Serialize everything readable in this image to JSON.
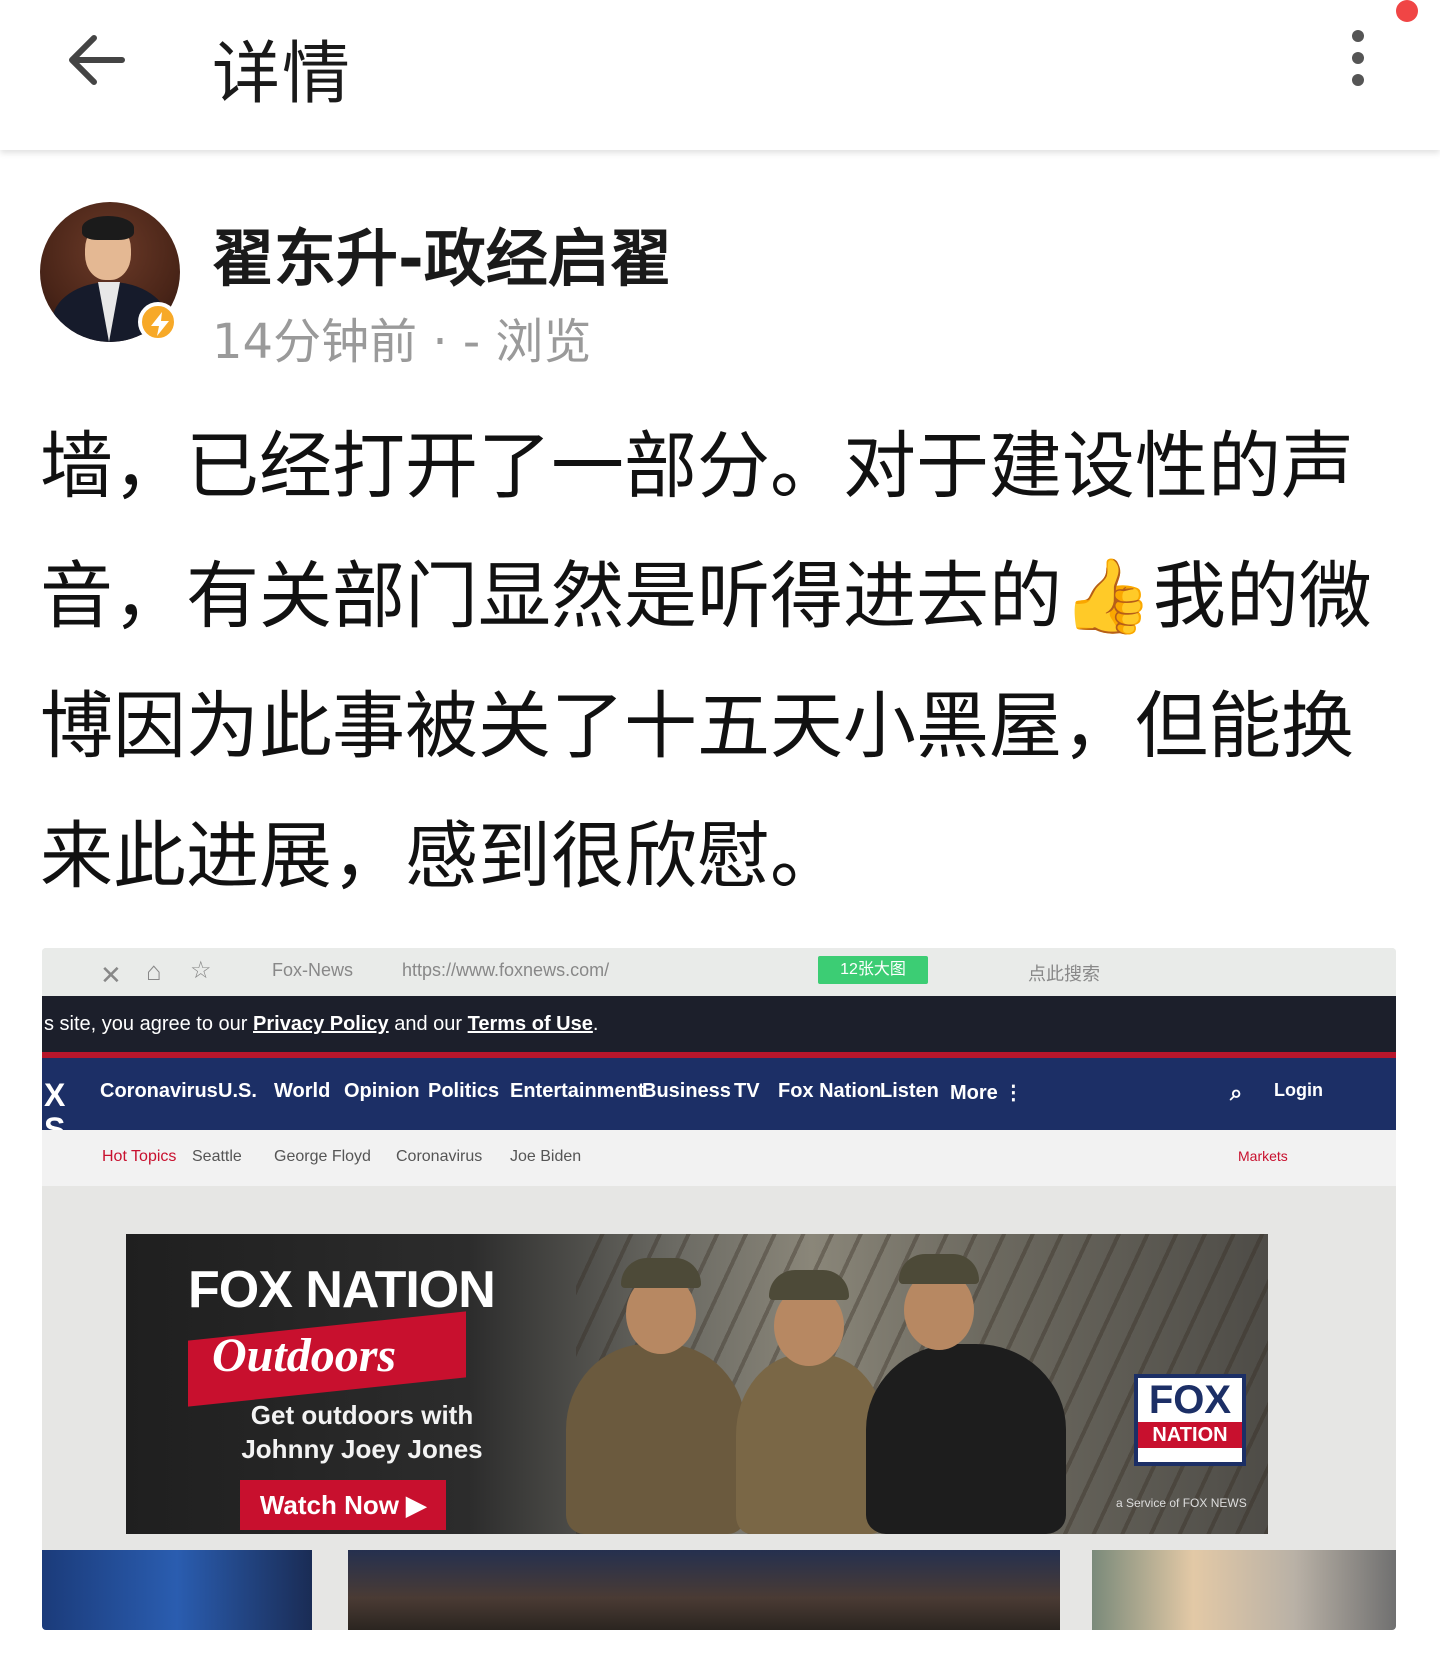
{
  "header": {
    "title": "详情"
  },
  "post": {
    "author": "翟东升-政经启翟",
    "meta": "14分钟前 · - 浏览",
    "text_part1": "墙，已经打开了一部分。对于建设性的声音，有关部门显然是听得进去的",
    "emoji": "👍",
    "text_part2": "我的微博因为此事被关了十五天小黑屋，但能换来此进展，感到很欣慰。"
  },
  "photo": {
    "browser": {
      "tab_label": "Fox-News",
      "url": "https://www.foxnews.com/",
      "green_button": "12张大图",
      "search_placeholder": "点此搜索"
    },
    "consent": {
      "prefix": "s site, you agree to our ",
      "privacy": "Privacy Policy",
      "middle": " and our ",
      "terms": "Terms of Use",
      "suffix": "."
    },
    "nav_items": [
      "Coronavirus",
      "U.S.",
      "World",
      "Opinion",
      "Politics",
      "Entertainment",
      "Business",
      "TV",
      "Fox Nation",
      "Listen",
      "More ⋮"
    ],
    "login": "Login",
    "hot_topics": [
      "Hot Topics",
      "Seattle",
      "George Floyd",
      "Coronavirus",
      "Joe Biden"
    ],
    "markets": "Markets",
    "hero": {
      "title": "FOX NATION",
      "subtitle": "Outdoors",
      "tagline": "Get outdoors with Johnny Joey Jones",
      "cta": "Watch Now ▶",
      "badge_top": "FOX",
      "badge_bottom": "NATION",
      "service": "a Service of FOX NEWS"
    }
  },
  "colors": {
    "notif": "#f04545",
    "verified": "#f7a928",
    "fox_navy": "#1c2f66",
    "fox_red": "#c8102e"
  },
  "icons": {
    "back": "arrow-left-icon",
    "more": "more-vertical-icon",
    "verified": "lightning-badge-icon"
  }
}
